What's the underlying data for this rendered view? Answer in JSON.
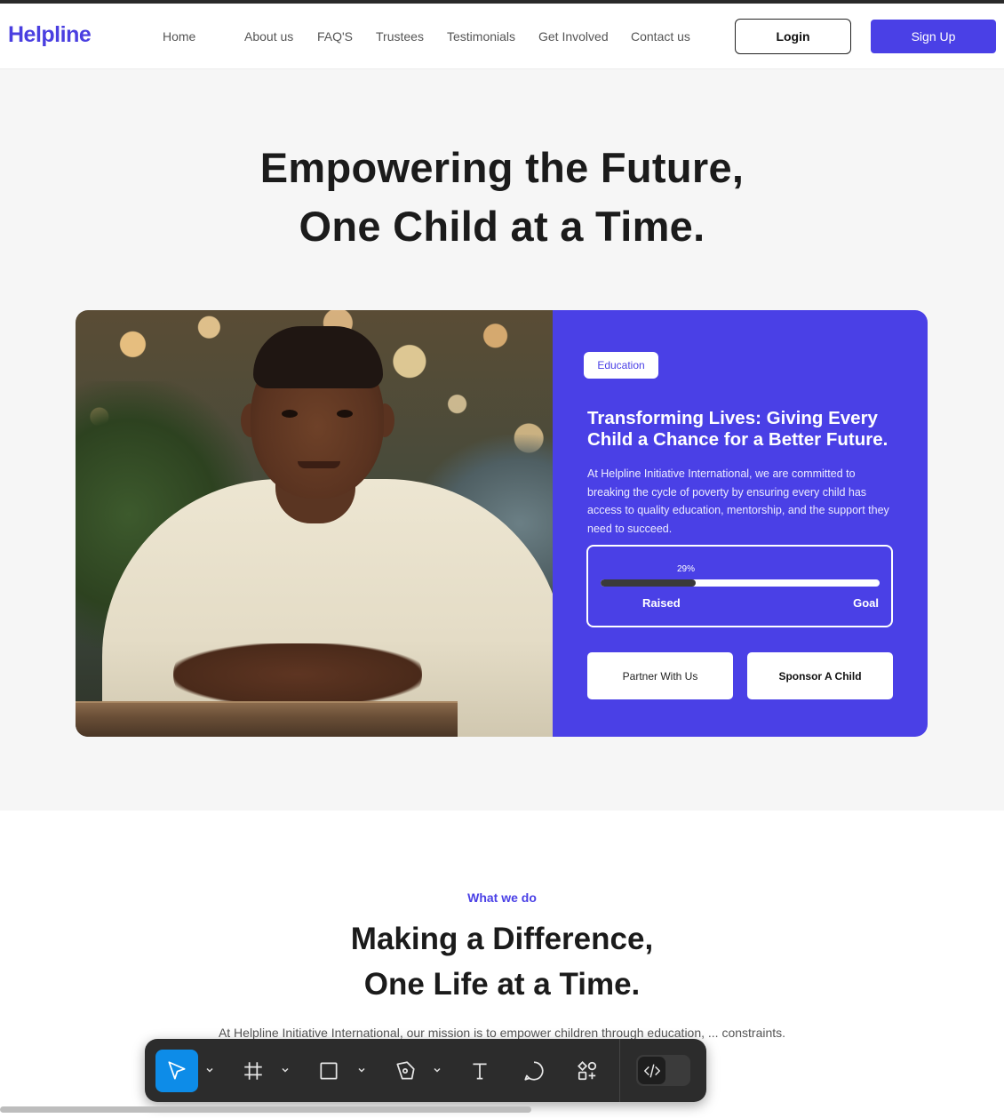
{
  "nav": {
    "logo": "Helpline",
    "links": [
      "Home",
      "About us",
      "FAQ'S",
      "Trustees",
      "Testimonials",
      "Get Involved",
      "Contact us"
    ],
    "login_label": "Login",
    "signup_label": "Sign Up"
  },
  "hero": {
    "title_line1": "Empowering the Future,",
    "title_line2": "One Child at a Time.",
    "card": {
      "chip": "Education",
      "title": "Transforming Lives: Giving Every Child a Chance for a Better Future.",
      "description": "At Helpline Initiative International, we are committed to breaking the cycle of poverty by ensuring every child has access to quality education, mentorship, and the support they need to succeed.",
      "progress": {
        "percent_label": "29%",
        "fraction": 0.34,
        "raised_label": "Raised",
        "goal_label": "Goal"
      },
      "partner_label": "Partner With Us",
      "sponsor_label": "Sponsor A Child"
    }
  },
  "what_we_do": {
    "eyebrow": "What we do",
    "title_line1": "Making a Difference,",
    "title_line2": "One Life at a Time.",
    "description": "At Helpline Initiative International, our mission is to empower children through education, ... constraints."
  },
  "toolbar": {
    "tools": [
      "move-icon",
      "frame-icon",
      "rectangle-icon",
      "pen-icon",
      "text-icon",
      "comment-icon",
      "actions-icon"
    ],
    "code_toggle": "dev-mode-icon"
  },
  "colors": {
    "brand": "#4a40e6",
    "toolbar_bg": "#2c2c2c",
    "tool_active": "#0d8ce8"
  }
}
